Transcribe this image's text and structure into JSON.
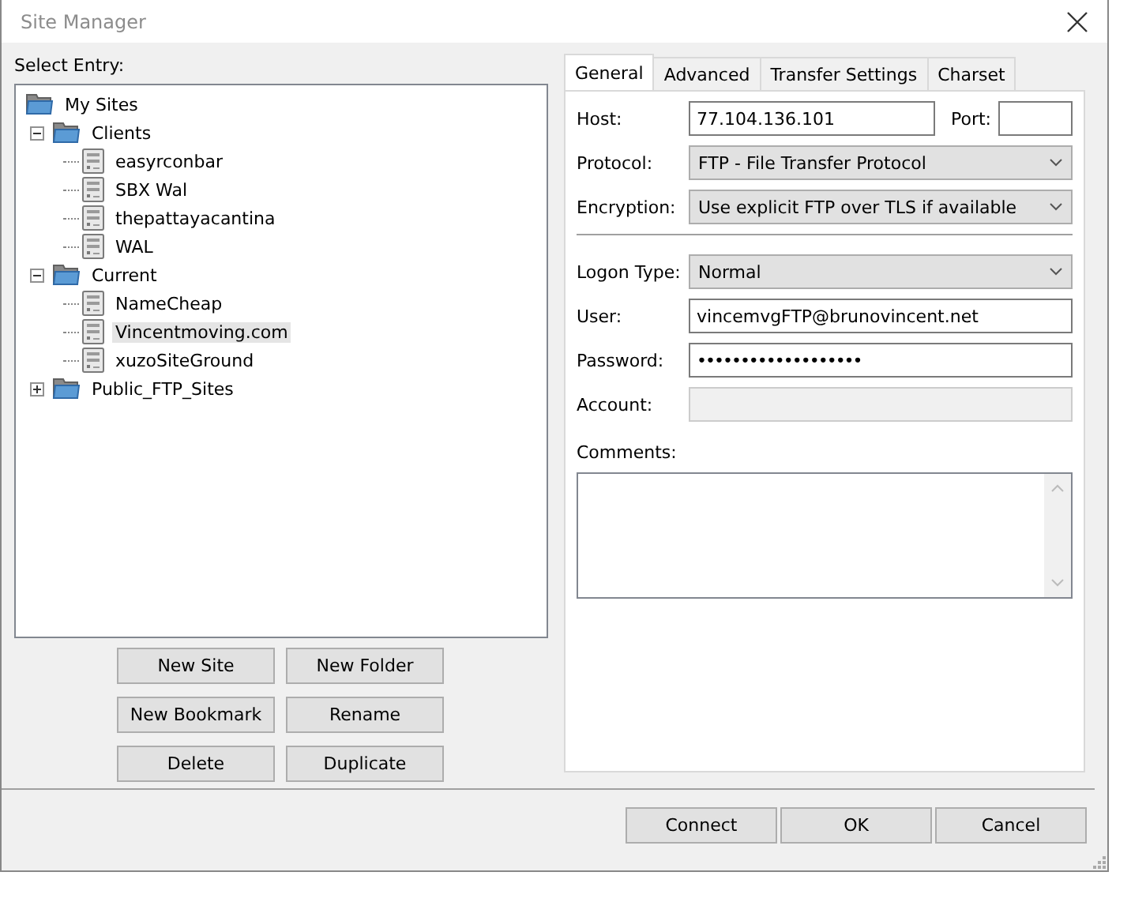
{
  "window": {
    "title": "Site Manager"
  },
  "tree": {
    "label": "Select Entry:",
    "items": [
      {
        "label": "My Sites",
        "kind": "root",
        "selected": false,
        "children": [
          {
            "label": "Clients",
            "kind": "folder",
            "expanded": true,
            "selected": false,
            "children": [
              {
                "label": "easyrconbar",
                "kind": "site",
                "selected": false
              },
              {
                "label": "SBX Wal",
                "kind": "site",
                "selected": false
              },
              {
                "label": "thepattayacantina",
                "kind": "site",
                "selected": false
              },
              {
                "label": "WAL",
                "kind": "site",
                "selected": false
              }
            ]
          },
          {
            "label": "Current",
            "kind": "folder",
            "expanded": true,
            "selected": false,
            "children": [
              {
                "label": "NameCheap",
                "kind": "site",
                "selected": false
              },
              {
                "label": "Vincentmoving.com",
                "kind": "site",
                "selected": true
              },
              {
                "label": "xuzoSiteGround",
                "kind": "site",
                "selected": false
              }
            ]
          },
          {
            "label": "Public_FTP_Sites",
            "kind": "folder",
            "expanded": false,
            "selected": false
          }
        ]
      }
    ]
  },
  "tree_buttons": [
    [
      "New Site",
      "New Folder"
    ],
    [
      "New Bookmark",
      "Rename"
    ],
    [
      "Delete",
      "Duplicate"
    ]
  ],
  "tabs": [
    {
      "label": "General",
      "selected": true
    },
    {
      "label": "Advanced",
      "selected": false
    },
    {
      "label": "Transfer Settings",
      "selected": false
    },
    {
      "label": "Charset",
      "selected": false
    }
  ],
  "general": {
    "host": {
      "label": "Host:",
      "value": "77.104.136.101"
    },
    "port": {
      "label": "Port:"
    },
    "fields": [
      {
        "kind": "select",
        "label": "Protocol:",
        "value": "FTP - File Transfer Protocol"
      },
      {
        "kind": "select",
        "label": "Encryption:",
        "value": "Use explicit FTP over TLS if available"
      },
      {
        "kind": "separator"
      },
      {
        "kind": "select",
        "label": "Logon Type:",
        "value": "Normal"
      },
      {
        "kind": "text",
        "label": "User:",
        "value": "vincemvgFTP@brunovincent.net"
      },
      {
        "kind": "password",
        "label": "Password:",
        "value": "•••••••••••••••••••"
      },
      {
        "kind": "disabled",
        "label": "Account:"
      }
    ],
    "comments": {
      "label": "Comments:"
    }
  },
  "buttons": [
    "Connect",
    "OK",
    "Cancel"
  ]
}
